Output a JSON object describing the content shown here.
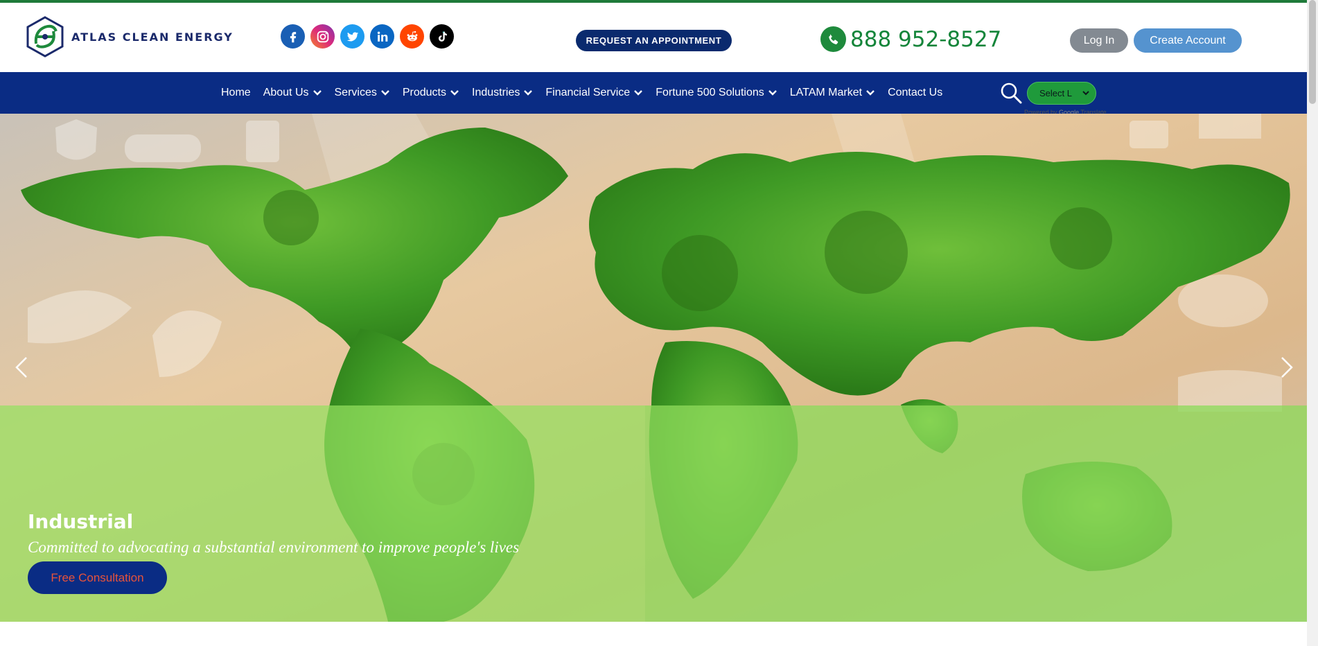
{
  "brand": {
    "name": "ATLAS CLEAN ENERGY",
    "primary_color": "#0a2c84",
    "accent_green": "#14853a"
  },
  "socials": [
    {
      "name": "facebook-icon"
    },
    {
      "name": "instagram-icon"
    },
    {
      "name": "twitter-icon"
    },
    {
      "name": "linkedin-icon"
    },
    {
      "name": "reddit-icon"
    },
    {
      "name": "tiktok-icon"
    }
  ],
  "header": {
    "appointment_label": "REQUEST AN APPOINTMENT",
    "phone": "888 952-8527",
    "login_label": "Log In",
    "create_account_label": "Create Account"
  },
  "nav": {
    "items": [
      {
        "label": "Home",
        "dropdown": false
      },
      {
        "label": "About Us",
        "dropdown": true
      },
      {
        "label": "Services",
        "dropdown": true
      },
      {
        "label": "Products",
        "dropdown": true
      },
      {
        "label": "Industries",
        "dropdown": true
      },
      {
        "label": "Financial Service",
        "dropdown": true
      },
      {
        "label": "Fortune 500 Solutions",
        "dropdown": true
      },
      {
        "label": "LATAM Market",
        "dropdown": true
      },
      {
        "label": "Contact Us",
        "dropdown": false
      }
    ],
    "language_select": "Select L",
    "powered_prefix": "Powered by",
    "powered_google": "Google",
    "powered_translate": "Translate"
  },
  "hero": {
    "title": "Industrial",
    "subtitle": "Committed to advocating a substantial environment to improve people's lives",
    "cta_label": "Free Consultation"
  }
}
